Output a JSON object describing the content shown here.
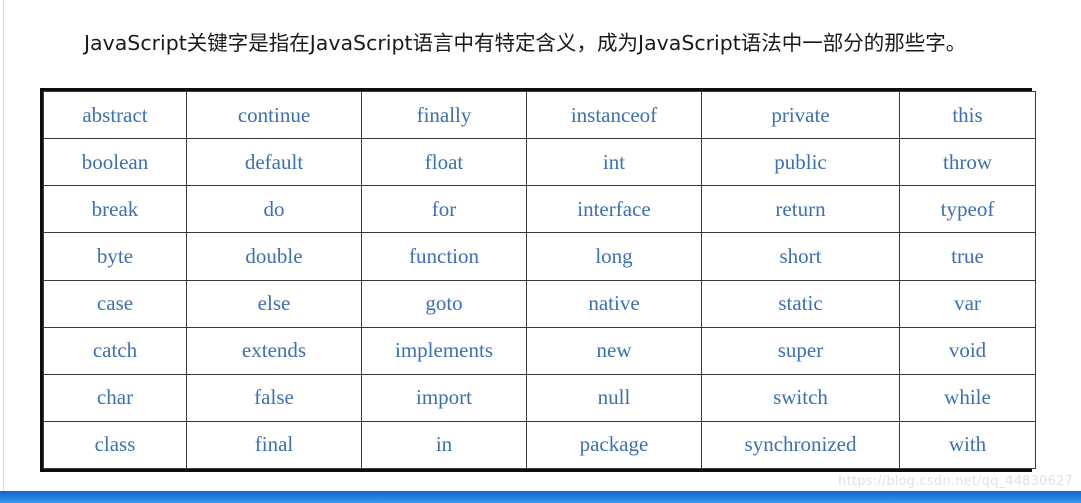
{
  "heading": {
    "text": "JavaScript关键字是指在JavaScript语言中有特定含义，成为JavaScript语法中一部分的那些字。"
  },
  "keyword_table": {
    "rows": [
      [
        "abstract",
        "continue",
        "finally",
        "instanceof",
        "private",
        "this"
      ],
      [
        "boolean",
        "default",
        "float",
        "int",
        "public",
        "throw"
      ],
      [
        "break",
        "do",
        "for",
        "interface",
        "return",
        "typeof"
      ],
      [
        "byte",
        "double",
        "function",
        "long",
        "short",
        "true"
      ],
      [
        "case",
        "else",
        "goto",
        "native",
        "static",
        "var"
      ],
      [
        "catch",
        "extends",
        "implements",
        "new",
        "super",
        "void"
      ],
      [
        "char",
        "false",
        "import",
        "null",
        "switch",
        "while"
      ],
      [
        "class",
        "final",
        "in",
        "package",
        "synchronized",
        "with"
      ]
    ]
  },
  "watermark": {
    "text": "https://blog.csdn.net/qq_44830627"
  },
  "colors": {
    "keyword_text": "#3d6fb4",
    "heading_text": "#1a1a1a",
    "table_border": "#0d0d0d",
    "cell_border": "#3a3a3a",
    "accent_bar": "#1b74d8",
    "watermark_text": "#e2e2e2"
  }
}
